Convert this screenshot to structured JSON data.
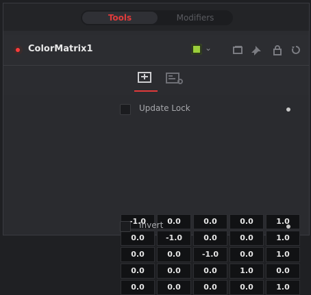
{
  "tabs": {
    "active": "Tools",
    "inactive": "Modifiers"
  },
  "node": {
    "name": "ColorMatrix1"
  },
  "icons": {
    "enable": "node-enable-dot-icon",
    "color": "node-color-swatch-icon",
    "chevron": "chevron-down-icon",
    "header_1": "version-icon",
    "header_2": "pin-icon",
    "header_3": "lock-icon",
    "header_4": "reset-icon",
    "tab_1": "controls-tab-icon",
    "tab_2": "settings-tab-icon"
  },
  "colors": {
    "accent": "#e23b3b",
    "swatch": "#9bcf3a"
  },
  "update_lock": {
    "label": "Update Lock",
    "checked": false
  },
  "invert": {
    "label": "Invert",
    "checked": false
  },
  "matrix": [
    [
      "-1.0",
      "0.0",
      "0.0",
      "0.0",
      "1.0"
    ],
    [
      "0.0",
      "-1.0",
      "0.0",
      "0.0",
      "1.0"
    ],
    [
      "0.0",
      "0.0",
      "-1.0",
      "0.0",
      "1.0"
    ],
    [
      "0.0",
      "0.0",
      "0.0",
      "1.0",
      "0.0"
    ],
    [
      "0.0",
      "0.0",
      "0.0",
      "0.0",
      "1.0"
    ]
  ]
}
